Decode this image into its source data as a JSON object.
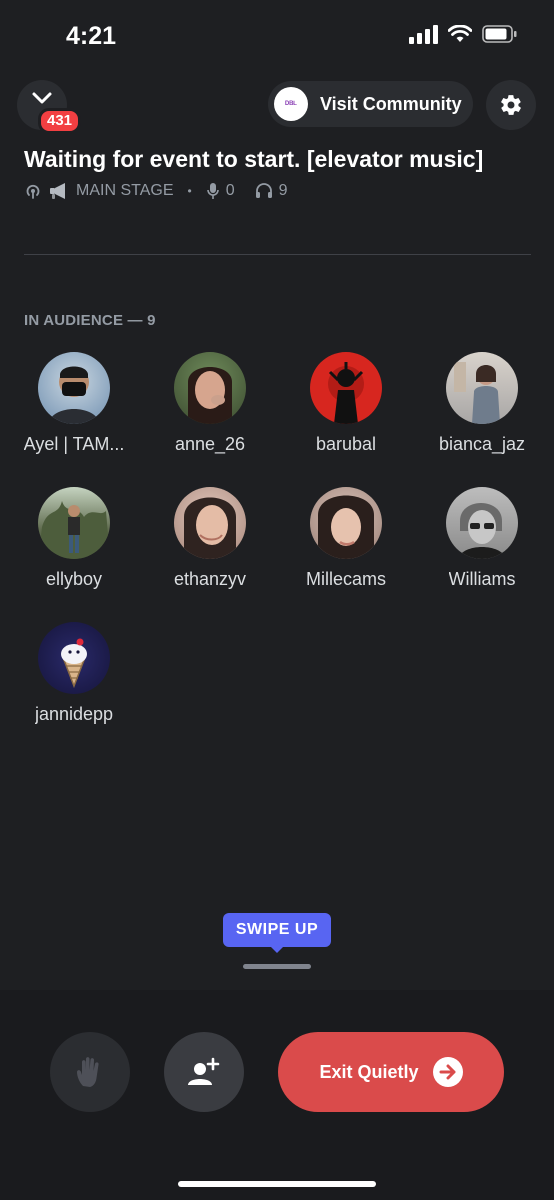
{
  "status_bar": {
    "time": "4:21"
  },
  "header": {
    "notification_count": "431",
    "visit_community_label": "Visit Community",
    "community_logo_text": "ᴰᴮᴸ"
  },
  "stage": {
    "title": "Waiting for event to start. [elevator music]",
    "channel_name": "MAIN STAGE",
    "speaker_count": "0",
    "listener_count": "9",
    "separator": "•"
  },
  "audience": {
    "section_label": "IN AUDIENCE — 9",
    "members": [
      {
        "name": "Ayel | TAM...",
        "avatar_color": "#6f8fb0"
      },
      {
        "name": "anne_26",
        "avatar_color": "#8a5a4a"
      },
      {
        "name": "barubal",
        "avatar_color": "#d7261f"
      },
      {
        "name": "bianca_jaz",
        "avatar_color": "#a8a6a5"
      },
      {
        "name": "ellyboy",
        "avatar_color": "#5f6b4e"
      },
      {
        "name": "ethanzyv",
        "avatar_color": "#a7867a"
      },
      {
        "name": "Millecams",
        "avatar_color": "#9a7f75"
      },
      {
        "name": "Williams",
        "avatar_color": "#8a8a8a"
      },
      {
        "name": "jannidepp",
        "avatar_color": "#15143a"
      }
    ]
  },
  "swipe": {
    "label": "SWIPE UP"
  },
  "actions": {
    "exit_label": "Exit Quietly"
  },
  "colors": {
    "background": "#1e1f22",
    "accent": "#5865f2",
    "danger": "#da4b4b",
    "badge": "#f23f42"
  }
}
